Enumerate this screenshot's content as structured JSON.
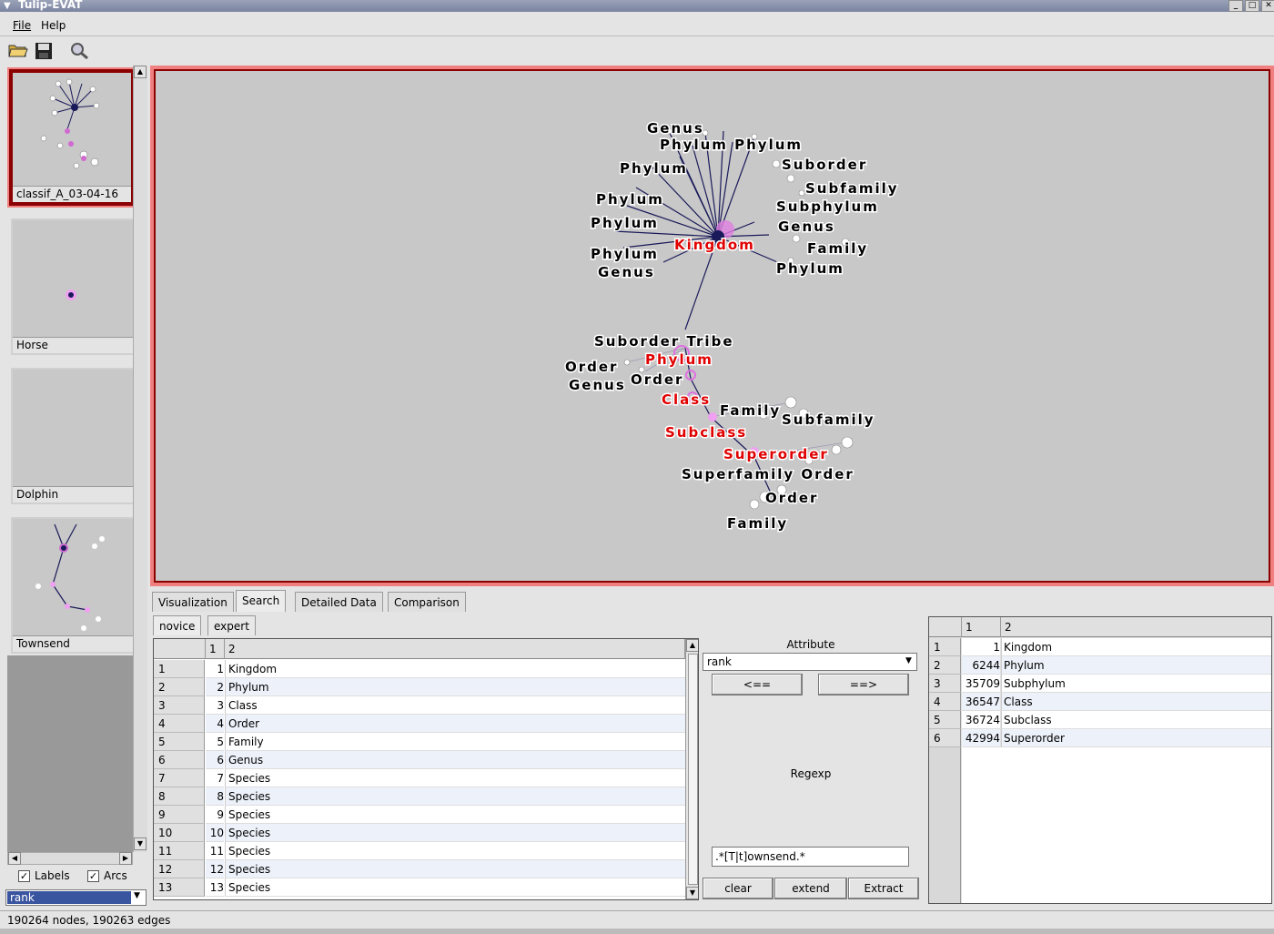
{
  "window": {
    "title": "Tulip-EVAT"
  },
  "menu": {
    "file": "File",
    "help": "Help"
  },
  "toolbar": {
    "open_icon": "open-folder-icon",
    "save_icon": "save-icon",
    "zoom_icon": "magnifier-icon"
  },
  "sidebar": {
    "thumbnails": [
      {
        "label": "classif_A_03-04-16",
        "selected": true
      },
      {
        "label": "Horse"
      },
      {
        "label": "Dolphin"
      },
      {
        "label": "Townsend"
      }
    ],
    "labels_checkbox": "Labels",
    "arcs_checkbox": "Arcs",
    "labels_checked": true,
    "arcs_checked": true,
    "property_select": "rank"
  },
  "graph": {
    "highlight_color": "#e00000",
    "label_color": "#000000",
    "edge_color": "#1a1a5a",
    "labels": [
      {
        "text": "Genus",
        "hl": false
      },
      {
        "text": "Phylum Phylum",
        "hl": false
      },
      {
        "text": "Phylum",
        "hl": false
      },
      {
        "text": "Suborder",
        "hl": false
      },
      {
        "text": "Subfamily",
        "hl": false
      },
      {
        "text": "Phylum",
        "hl": false
      },
      {
        "text": "Subphylum",
        "hl": false
      },
      {
        "text": "Phylum",
        "hl": false
      },
      {
        "text": "Genus",
        "hl": false
      },
      {
        "text": "Kingdom",
        "hl": true
      },
      {
        "text": "Family",
        "hl": false
      },
      {
        "text": "Phylum",
        "hl": false
      },
      {
        "text": "Genus",
        "hl": false
      },
      {
        "text": "Phylum",
        "hl": false
      },
      {
        "text": "Suborder Tribe",
        "hl": false
      },
      {
        "text": "Phylum",
        "hl": true
      },
      {
        "text": "Order",
        "hl": false
      },
      {
        "text": "Order",
        "hl": false
      },
      {
        "text": "Genus",
        "hl": false
      },
      {
        "text": "Class",
        "hl": true
      },
      {
        "text": "Family",
        "hl": false
      },
      {
        "text": "Subfamily",
        "hl": false
      },
      {
        "text": "Subclass",
        "hl": true
      },
      {
        "text": "Superorder",
        "hl": true
      },
      {
        "text": "Superfamily Order",
        "hl": false
      },
      {
        "text": "Order",
        "hl": false
      },
      {
        "text": "Family",
        "hl": false
      }
    ]
  },
  "tabs": [
    "Visualization",
    "Search",
    "Detailed Data",
    "Comparison"
  ],
  "active_tab": "Search",
  "subtabs": [
    "novice",
    "expert"
  ],
  "left_table": {
    "headers": [
      "1",
      "2"
    ],
    "rows": [
      {
        "n": "1",
        "id": "1",
        "rank": "Kingdom"
      },
      {
        "n": "2",
        "id": "2",
        "rank": "Phylum"
      },
      {
        "n": "3",
        "id": "3",
        "rank": "Class"
      },
      {
        "n": "4",
        "id": "4",
        "rank": "Order"
      },
      {
        "n": "5",
        "id": "5",
        "rank": "Family"
      },
      {
        "n": "6",
        "id": "6",
        "rank": "Genus"
      },
      {
        "n": "7",
        "id": "7",
        "rank": "Species"
      },
      {
        "n": "8",
        "id": "8",
        "rank": "Species"
      },
      {
        "n": "9",
        "id": "9",
        "rank": "Species"
      },
      {
        "n": "10",
        "id": "10",
        "rank": "Species"
      },
      {
        "n": "11",
        "id": "11",
        "rank": "Species"
      },
      {
        "n": "12",
        "id": "12",
        "rank": "Species"
      },
      {
        "n": "13",
        "id": "13",
        "rank": "Species"
      }
    ]
  },
  "attribute_panel": {
    "title": "Attribute",
    "select_value": "rank",
    "left_button": "<==",
    "right_button": "==>",
    "regexp_label": "Regexp",
    "regexp_value": ".*[T|t]ownsend.*",
    "clear": "clear",
    "extend": "extend",
    "extract": "Extract"
  },
  "right_table": {
    "headers": [
      "1",
      "2"
    ],
    "rows": [
      {
        "n": "1",
        "id": "1",
        "rank": "Kingdom"
      },
      {
        "n": "2",
        "id": "6244",
        "rank": "Phylum"
      },
      {
        "n": "3",
        "id": "35709",
        "rank": "Subphylum"
      },
      {
        "n": "4",
        "id": "36547",
        "rank": "Class"
      },
      {
        "n": "5",
        "id": "36724",
        "rank": "Subclass"
      },
      {
        "n": "6",
        "id": "42994",
        "rank": "Superorder"
      }
    ]
  },
  "status": "190264 nodes, 190263 edges"
}
